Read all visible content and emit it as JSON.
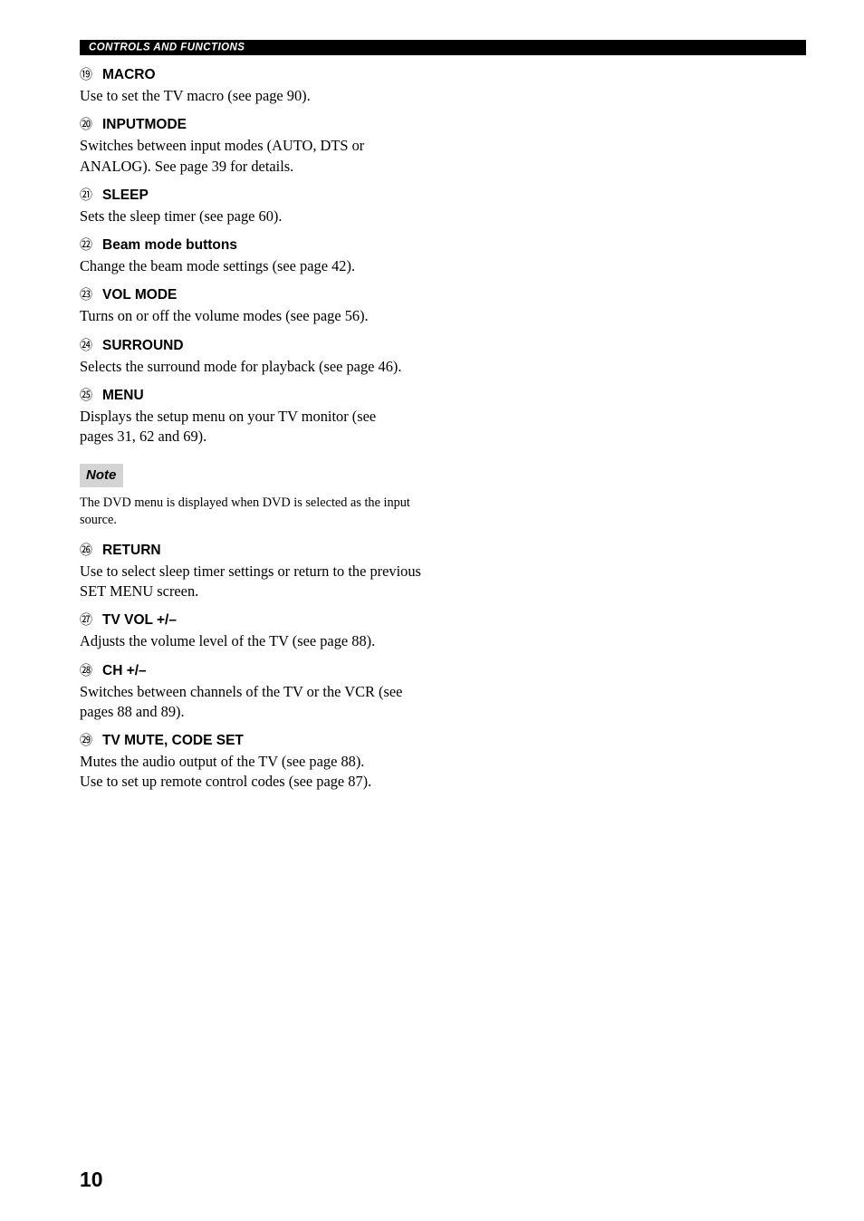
{
  "header": {
    "running_title": "CONTROLS AND FUNCTIONS",
    "bar_color": "#000000",
    "text_color": "#ffffff"
  },
  "entries": [
    {
      "number": "⑲",
      "title": "MACRO",
      "lines": [
        "Use to set the TV macro (see page 90)."
      ]
    },
    {
      "number": "⑳",
      "title": "INPUTMODE",
      "lines": [
        "Switches between input modes (AUTO, DTS or",
        "ANALOG). See page 39 for details."
      ]
    },
    {
      "number": "㉑",
      "title": "SLEEP",
      "lines": [
        "Sets the sleep timer (see page 60)."
      ]
    },
    {
      "number": "㉒",
      "title": "Beam mode buttons",
      "lines": [
        "Change the beam mode settings (see page 42)."
      ]
    },
    {
      "number": "㉓",
      "title": "VOL MODE",
      "lines": [
        "Turns on or off the volume modes (see page 56)."
      ]
    },
    {
      "number": "㉔",
      "title": "SURROUND",
      "lines": [
        "Selects the surround mode for playback (see page 46)."
      ]
    },
    {
      "number": "㉕",
      "title": "MENU",
      "lines": [
        "Displays the setup menu on your TV monitor (see",
        "pages 31, 62 and 69)."
      ]
    }
  ],
  "note": {
    "label": "Note",
    "badge_color": "#d4d4d4",
    "lines": [
      "The DVD menu is displayed when DVD is selected as the input",
      "source."
    ]
  },
  "entries_after_note": [
    {
      "number": "㉖",
      "title": "RETURN",
      "lines": [
        "Use to select sleep timer settings or return to the previous",
        "SET MENU screen."
      ]
    },
    {
      "number": "㉗",
      "title": "TV VOL +/–",
      "lines": [
        "Adjusts the volume level of the TV (see page 88)."
      ]
    },
    {
      "number": "㉘",
      "title": "CH +/–",
      "lines": [
        "Switches between channels of the TV or the VCR (see",
        "pages 88 and 89)."
      ]
    },
    {
      "number": "㉙",
      "title": "TV MUTE, CODE SET",
      "lines": [
        "Mutes the audio output of the TV (see page 88).",
        "Use to set up remote control codes (see page 87)."
      ]
    }
  ],
  "folio": {
    "page_number": "10"
  }
}
